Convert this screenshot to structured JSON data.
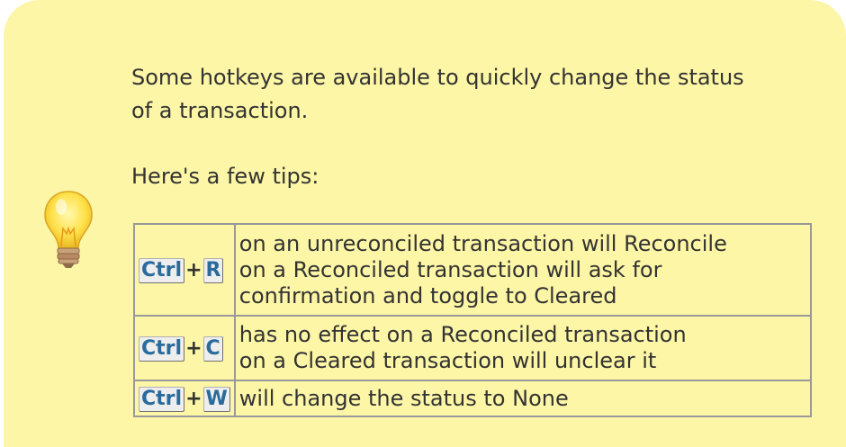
{
  "tip": {
    "intro": "Some hotkeys are available to quickly change the status of a transaction.",
    "intro_line1": "Some hotkeys are available to quickly change the status",
    "intro_line2": "of a transaction.",
    "tips_heading": "Here's a few tips:",
    "background_color": "#fdf6a6",
    "icon": "lightbulb-icon"
  },
  "hotkeys": [
    {
      "modifier": "Ctrl",
      "plus": "+",
      "key": "R",
      "lines": [
        "on an unreconciled transaction will Reconcile",
        "on a Reconciled transaction will ask for",
        "confirmation and toggle to Cleared"
      ]
    },
    {
      "modifier": "Ctrl",
      "plus": "+",
      "key": "C",
      "lines": [
        "has no effect on a Reconciled transaction",
        "on a Cleared transaction will unclear it"
      ]
    },
    {
      "modifier": "Ctrl",
      "plus": "+",
      "key": "W",
      "lines": [
        "will change the status to None"
      ]
    }
  ]
}
